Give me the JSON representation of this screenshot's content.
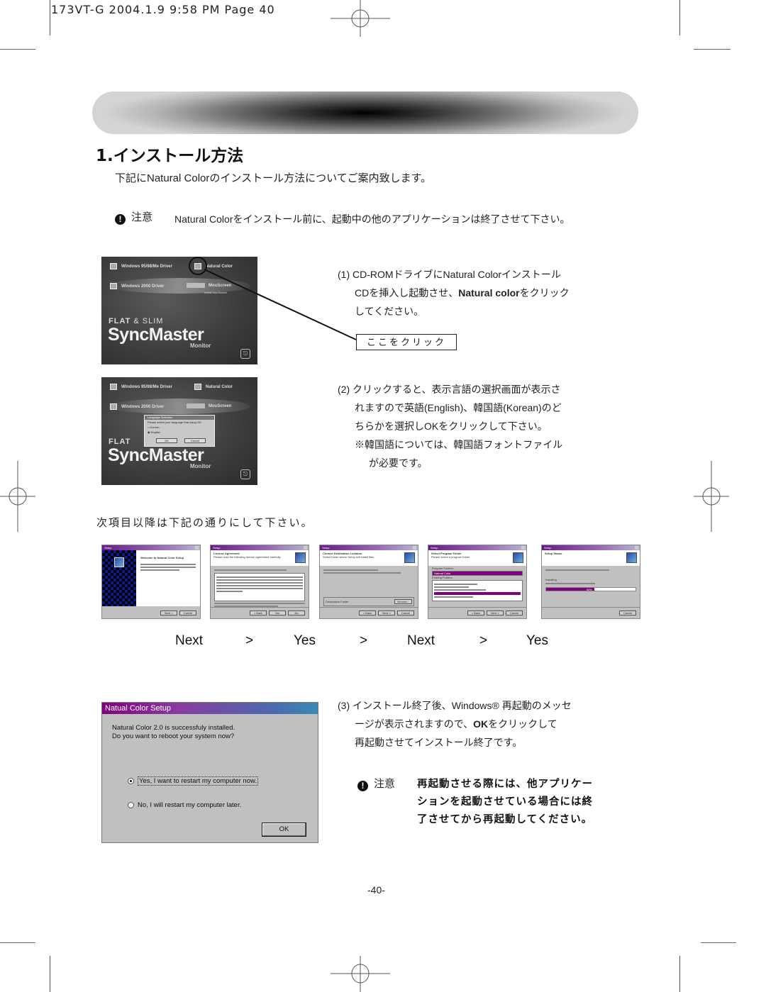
{
  "slug": "173VT-G 2004.1.9 9:58 PM Page 40",
  "section": {
    "title": "1.インストール方法",
    "intro": "下記にNatural Colorのインストール方法についてご案内致します。",
    "caution_label": "注意",
    "caution_icon": "exclamation-icon",
    "caution_text": "Natural Colorをインストール前に、起動中の他のアプリケーションは終了させて下さい。"
  },
  "screenshots": {
    "syncmaster": {
      "menu_driver_9x": "Windows 95/98/Me Driver",
      "menu_driver_2000": "Windows 2000 Driver",
      "menu_natural_color": "Natural Color",
      "menu_mouscreen": "MouScreen",
      "menu_mouscreen_sub": "Install MouScreen",
      "flat_slim_bold": "FLAT",
      "flat_slim_rest": " & SLIM",
      "brand": "SyncMaster",
      "sub_brand": "Monitor",
      "exit_icon": "exit-icon"
    },
    "language_dialog": {
      "title": "Language Selection",
      "prompt": "Please select your language that using OS.",
      "options": [
        "Korean",
        "English"
      ],
      "ok": "OK",
      "cancel": "Cancel"
    }
  },
  "steps": [
    {
      "number": "(1)",
      "line1": "CD-ROMドライブにNatural Colorインストール",
      "line2_pre": "CDを挿入し起動させ、",
      "line2_bold": "Natural color",
      "line2_post": "をクリック",
      "line3": "してください。",
      "callout": "ここをクリック"
    },
    {
      "number": "(2)",
      "line1": "クリックすると、表示言語の選択画面が表示さ",
      "line2": "れますので英語(English)、韓国語(Korean)のど",
      "line3": "ちらかを選択しOKをクリックして下さい。",
      "line4": "※韓国語については、韓国語フォントファイル",
      "line5": "が必要です。"
    },
    {
      "number": "(3)",
      "line1": "インストール終了後、Windows® 再起動のメッセ",
      "line2_pre": "ージが表示されますので、",
      "line2_bold": "OK",
      "line2_post": "をクリックして",
      "line3": "再起動させてインストール終了です。"
    }
  ],
  "next_section": "次項目以降は下記の通りにして下さい。",
  "wizard_screens": [
    {
      "title": "Setup",
      "heading": "Welcome to Natural Color Setup",
      "buttons": [
        "Next >",
        "Cancel"
      ]
    },
    {
      "title": "Setup",
      "heading": "License Agreement",
      "sub": "Please read the following license agreement carefully.",
      "buttons": [
        "< Back",
        "Yes",
        "No"
      ]
    },
    {
      "title": "Setup",
      "heading": "Choose Destination Location",
      "sub": "Select folder where Setup will install files.",
      "folder_label": "Destination Folder",
      "browse": "Browse...",
      "buttons": [
        "< Back",
        "Next >",
        "Cancel"
      ]
    },
    {
      "title": "Setup",
      "heading": "Select Program Folder",
      "sub": "Please select a program folder.",
      "program_folder_label": "Program Folders:",
      "existing_label": "Existing Folders:",
      "selected_folder": "Natural Color",
      "buttons": [
        "< Back",
        "Next >",
        "Cancel"
      ]
    },
    {
      "title": "Setup",
      "heading": "Setup Status",
      "status": "Installing",
      "progress_percent": 54,
      "progress_label": "54%",
      "buttons": [
        "Cancel"
      ]
    }
  ],
  "flow": {
    "items": [
      "Next",
      ">",
      "Yes",
      ">",
      "Next",
      ">",
      "Yes"
    ]
  },
  "final_dialog": {
    "title": "Natual Color Setup",
    "message_line1": "Natural Color 2.0 is successfuly installed.",
    "message_line2": "Do you want to reboot your system now?",
    "option_yes": "Yes, I want to restart my computer now.",
    "option_no": "No, I will restart my computer later.",
    "selected": "yes",
    "ok": "OK"
  },
  "caution2": {
    "label": "注意",
    "line1": "再起動させる際には、他アプリケー",
    "line2": "ションを起動させている場合には終",
    "line3": "了させてから再起動してください。"
  },
  "page_number": "-40-"
}
